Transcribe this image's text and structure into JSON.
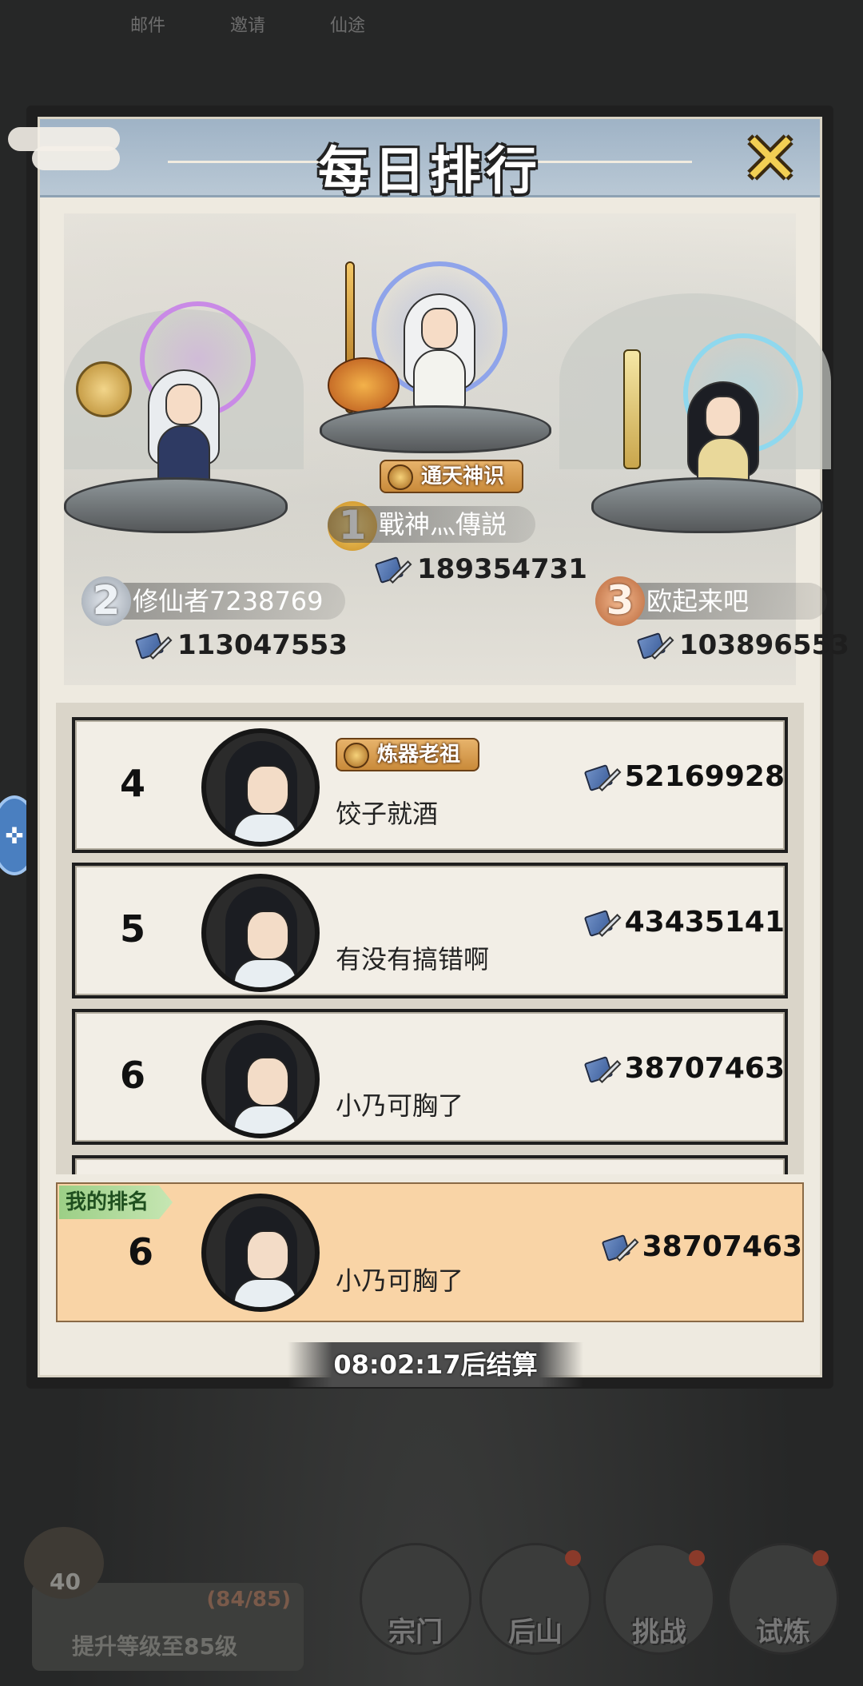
{
  "top_icons": [
    "邮件",
    "邀请",
    "仙途"
  ],
  "panel": {
    "title": "每日排行",
    "close_icon": "close-x-icon"
  },
  "podium": [
    {
      "rank": "2",
      "name": "修仙者7238769",
      "power": "113047553"
    },
    {
      "rank": "1",
      "name": "戰神灬傳説",
      "power": "189354731",
      "tag": "通天神识"
    },
    {
      "rank": "3",
      "name": "欧起来吧",
      "power": "103896553"
    }
  ],
  "list": [
    {
      "rank": "4",
      "name": "饺子就酒",
      "power": "52169928",
      "tag": "炼器老祖"
    },
    {
      "rank": "5",
      "name": "有没有搞错啊",
      "power": "43435141"
    },
    {
      "rank": "6",
      "name": "小乃可胸了",
      "power": "38707463"
    }
  ],
  "my_rank": {
    "label": "我的排名",
    "rank": "6",
    "name": "小乃可胸了",
    "power": "38707463"
  },
  "settle_text": "08:02:17后结算",
  "bottom": {
    "chest_level": "40",
    "progress": "(84/85)",
    "upgrade_text": "提升等级至85级",
    "nav": [
      "宗门",
      "后山",
      "挑战",
      "试炼"
    ]
  },
  "colors": {
    "title_bar": "#9fb3c6",
    "my_rank_bg": "#f9d4a6",
    "row_bg": "#f2eee6"
  }
}
